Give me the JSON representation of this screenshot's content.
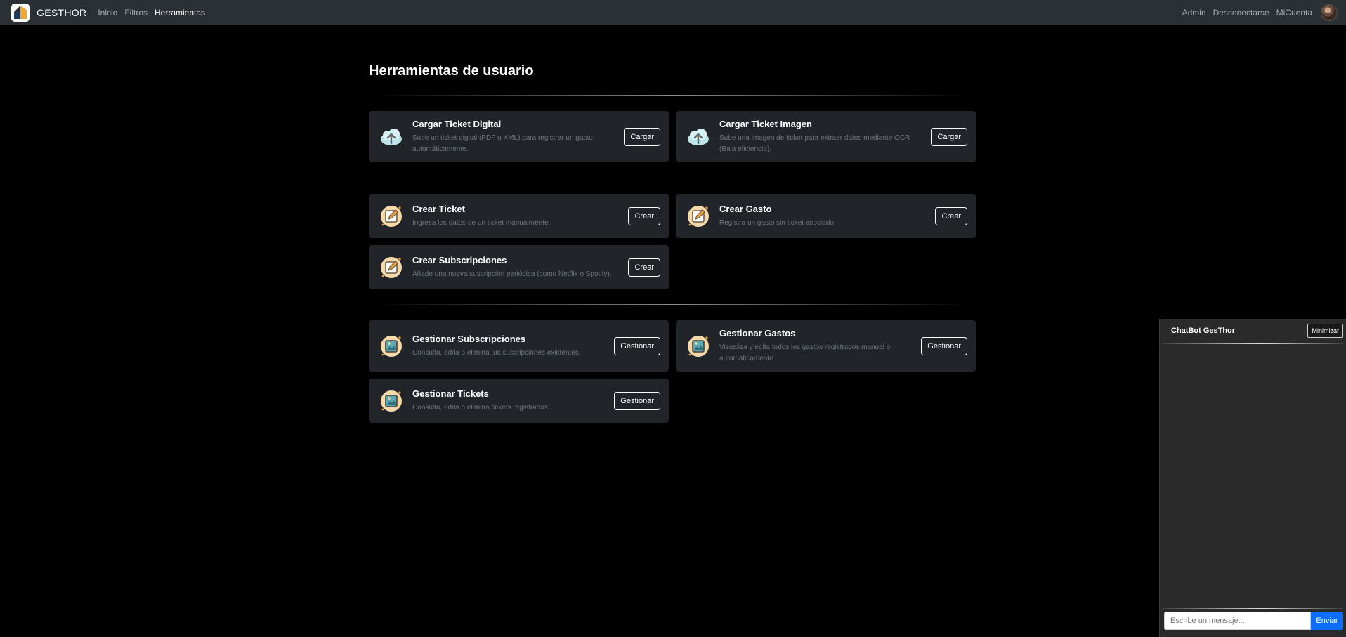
{
  "navbar": {
    "brand": "GESTHOR",
    "links": [
      {
        "label": "Inicio"
      },
      {
        "label": "Filtros"
      },
      {
        "label": "Herramientas"
      }
    ],
    "right": [
      "Admin",
      "Desconectarse",
      "MiCuenta"
    ]
  },
  "page": {
    "title": "Herramientas de usuario"
  },
  "sections": [
    [
      {
        "title": "Cargar Ticket Digital",
        "desc": "Sube un ticket digital (PDF o XML) para registrar un gasto automáticamente.",
        "button": "Cargar",
        "icon": "cloud-upload-icon"
      },
      {
        "title": "Cargar Ticket Imagen",
        "desc": "Sube una imagen de ticket para extraer datos mediante OCR (Baja eficiencia).",
        "button": "Cargar",
        "icon": "cloud-upload-icon"
      }
    ],
    [
      {
        "title": "Crear Ticket",
        "desc": "Ingresa los datos de un ticket manualmente.",
        "button": "Crear",
        "icon": "edit-icon"
      },
      {
        "title": "Crear Gasto",
        "desc": "Registra un gasto sin ticket asociado.",
        "button": "Crear",
        "icon": "edit-icon"
      },
      {
        "title": "Crear Subscripciones",
        "desc": "Añade una nueva suscripción periódica (como Netflix o Spotify).",
        "button": "Crear",
        "icon": "edit-icon"
      }
    ],
    [
      {
        "title": "Gestionar Subscripciones",
        "desc": "Consulta, edita o elimina tus suscripciones existentes.",
        "button": "Gestionar",
        "icon": "image-manage-icon"
      },
      {
        "title": "Gestionar Gastos",
        "desc": "Visualiza y edita todos los gastos registrados manual o automáticamente.",
        "button": "Gestionar",
        "icon": "image-manage-icon"
      },
      {
        "title": "Gestionar Tickets",
        "desc": "Consulta, edita o elimina tickets registrados.",
        "button": "Gestionar",
        "icon": "image-manage-icon"
      }
    ]
  ],
  "chat": {
    "title": "ChatBot GesThor",
    "minimize": "Minimizar",
    "placeholder": "Escribe un mensaje...",
    "send": "Enviar"
  },
  "colors": {
    "navbar_bg": "#2b3035",
    "card_bg": "#212529",
    "page_bg": "#000000",
    "accent": "#0d6efd"
  }
}
